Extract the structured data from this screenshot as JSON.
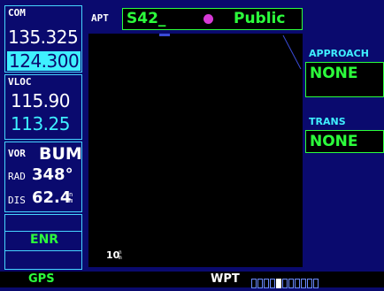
{
  "com": {
    "label": "COM",
    "active": "135.325",
    "standby": "124.300"
  },
  "vloc": {
    "label": "VLOC",
    "active": "115.90",
    "standby": "113.25"
  },
  "vor": {
    "label": "VOR",
    "ident": "BUM",
    "rad_label": "RAD",
    "rad_value": "348°",
    "dis_label": "DIS",
    "dis_value": "62.4",
    "dis_unit": "nm"
  },
  "mode": {
    "label": "ENR"
  },
  "header": {
    "apt_label": "APT",
    "ident": "S42_",
    "type": "Public"
  },
  "map": {
    "range": "10",
    "range_unit": "nm"
  },
  "approach": {
    "label": "APPROACH",
    "value": "NONE"
  },
  "trans": {
    "label": "TRANS",
    "value": "NONE"
  },
  "status": {
    "gps_label": "GPS",
    "page_label": "WPT",
    "page_index": 4,
    "page_count": 11
  },
  "colors": {
    "background": "#0a0a6e",
    "cyan": "#3ff0ff",
    "green": "#2cff3c",
    "white": "#ffffff"
  }
}
